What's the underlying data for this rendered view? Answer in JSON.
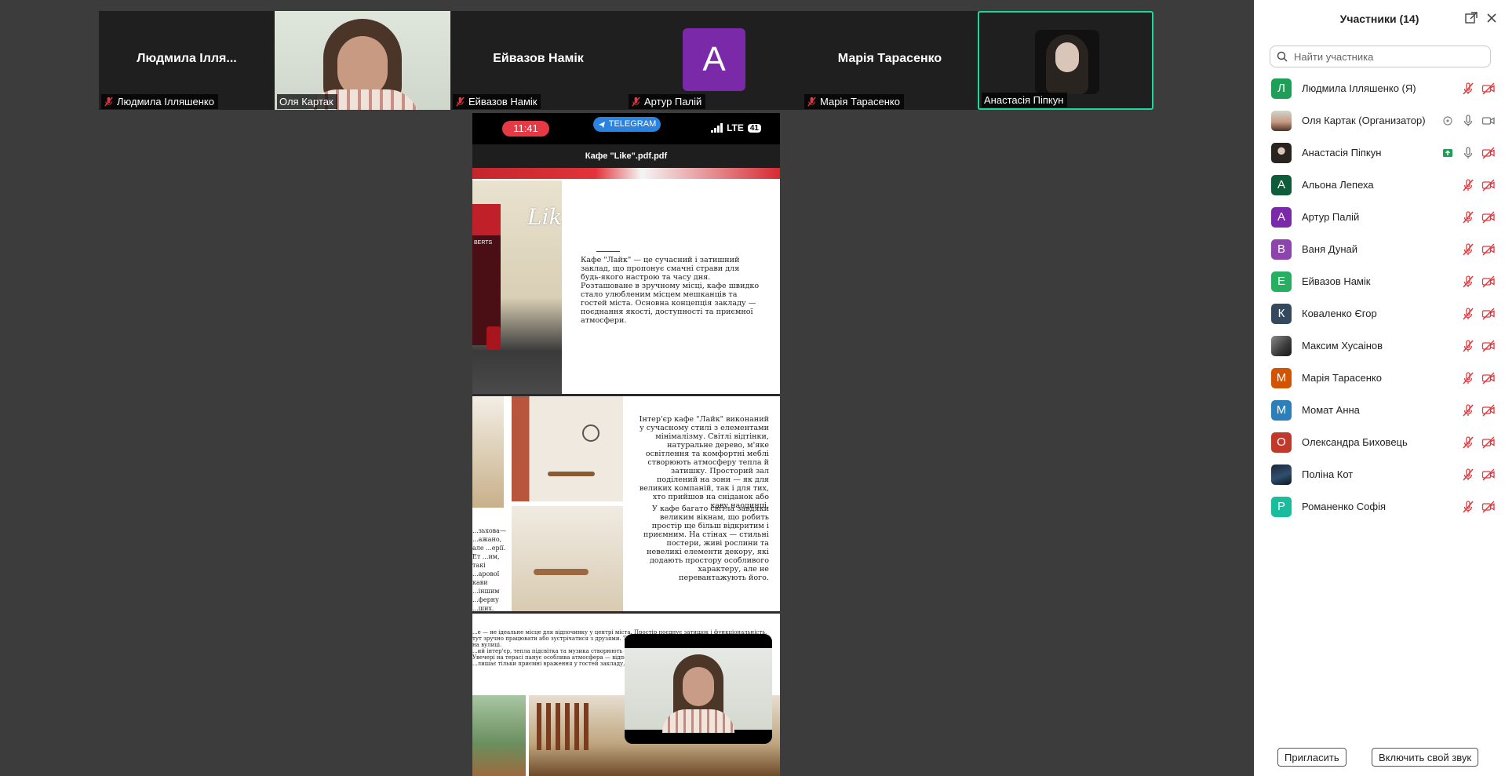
{
  "strip": {
    "tiles": [
      {
        "big_name": "Людмила Ілля...",
        "label": "Людмила Ілляшенко",
        "muted": true
      },
      {
        "label": "Оля Картак",
        "muted": false
      },
      {
        "big_name": "Ейвазов Намік",
        "label": "Ейвазов Намік",
        "muted": true
      },
      {
        "avatar_letter": "A",
        "avatar_color": "#7a2aa8",
        "label": "Артур Палій",
        "muted": true
      },
      {
        "big_name": "Марія Тарасенко",
        "label": "Марія Тарасенко",
        "muted": true
      },
      {
        "label": "Анастасія Піпкун",
        "muted": false,
        "active": true
      }
    ]
  },
  "share": {
    "phone": {
      "time": "11:41",
      "telegram": "TELEGRAM",
      "network": "LTE",
      "battery": "41"
    },
    "pdf_title": "Кафе \"Like\".pdf.pdf",
    "sign_text": "Like",
    "sign_text_left": "BERTS",
    "para1": "Кафе \"Лайк\" — це сучасний і затишний заклад, що пропонує смачні страви для будь-якого настрою та часу дня. Розташоване в зручному місці, кафе швидко стало улюбленим місцем мешканців та гостей міста. Основна концепція закладу — поєднання якості, доступності та приємної атмосфери.",
    "para2": "Інтер'єр кафе \"Лайк\" виконаний у сучасному стилі з елементами мінімалізму. Світлі відтінки, натуральне дерево, м'яке освітлення та комфортні меблі створюють атмосферу тепла й затишку. Просторий зал поділений на зони — як для великих компаній, так і для тих, хто прийшов на сніданок або каву наодинці.",
    "para3": "У кафе багато світла завдяки великим вікнам, що робить простір ще більш відкритим і приємним. На стінах — стильні постери, живі рослини та невеликі елементи декору, які додають простору особливого характеру, але не перевантажують його.",
    "para_side": "...зьхова— ...ажано, але ...ерії. Ет ...им, такі ...арової кави ...іншим ...ферну ...ших.",
    "para4": "...е — не ідеальне місце для відпочинку у центрі міста. Простір поєднує затишок і функціональність, тут зручно працювати або зустрічатися з друзями. Терасa підходить для всіх, хто цінує свіже повітря на вулиці.\n...ий інтер'єр, тепла підсвітка та музика створюють атмосферу, у якій хочеться залишатися довше. Увечері на терасі панує особлива атмосфера — відпочинок та спілкування з кавою або десертом.\n...лишає тільки приємні враження у гостей закладу, а саме це і є ключова мета."
  },
  "panel": {
    "title": "Участники (14)",
    "search_placeholder": "Найти участника",
    "participants": [
      {
        "name": "Людмила Ілляшенко (Я)",
        "letter": "Л",
        "color": "#1e9e57",
        "icons": [
          "mic-off",
          "video-off"
        ]
      },
      {
        "name": "Оля Картак (Организатор)",
        "photo": "olya",
        "icons": [
          "record",
          "mic-on",
          "video-on"
        ]
      },
      {
        "name": "Анастасія Піпкун",
        "photo": "ana",
        "icons": [
          "share-screen",
          "mic-on",
          "video-off"
        ]
      },
      {
        "name": "Альона Лепеха",
        "letter": "А",
        "color": "#0f5c3a",
        "icons": [
          "mic-off",
          "video-off"
        ]
      },
      {
        "name": "Артур Палій",
        "letter": "А",
        "color": "#7a2aa8",
        "icons": [
          "mic-off",
          "video-off"
        ]
      },
      {
        "name": "Ваня Дунай",
        "letter": "В",
        "color": "#8e44ad",
        "icons": [
          "mic-off",
          "video-off"
        ]
      },
      {
        "name": "Ейвазов Намік",
        "letter": "Е",
        "color": "#27ae60",
        "icons": [
          "mic-off",
          "video-off"
        ]
      },
      {
        "name": "Коваленко Єгор",
        "letter": "К",
        "color": "#34495e",
        "icons": [
          "mic-off",
          "video-off"
        ]
      },
      {
        "name": "Максим Хусаінов",
        "photo": "maksym",
        "icons": [
          "mic-off",
          "video-off"
        ]
      },
      {
        "name": "Марія Тарасенко",
        "letter": "М",
        "color": "#d35400",
        "icons": [
          "mic-off",
          "video-off"
        ]
      },
      {
        "name": "Момат Анна",
        "letter": "М",
        "color": "#2c7fb8",
        "icons": [
          "mic-off",
          "video-off"
        ]
      },
      {
        "name": "Олександра Биховець",
        "letter": "О",
        "color": "#c0392b",
        "icons": [
          "mic-off",
          "video-off"
        ]
      },
      {
        "name": "Поліна Кот",
        "photo": "polina",
        "icons": [
          "mic-off",
          "video-off"
        ]
      },
      {
        "name": "Романенко Софія",
        "letter": "Р",
        "color": "#1abc9c",
        "icons": [
          "mic-off",
          "video-off"
        ]
      }
    ],
    "invite_label": "Пригласить",
    "unmute_label": "Включить свой звук"
  },
  "colors": {
    "active_border": "#1dd89c",
    "muted_red": "#e0393e",
    "background": "#3c3c3c"
  }
}
